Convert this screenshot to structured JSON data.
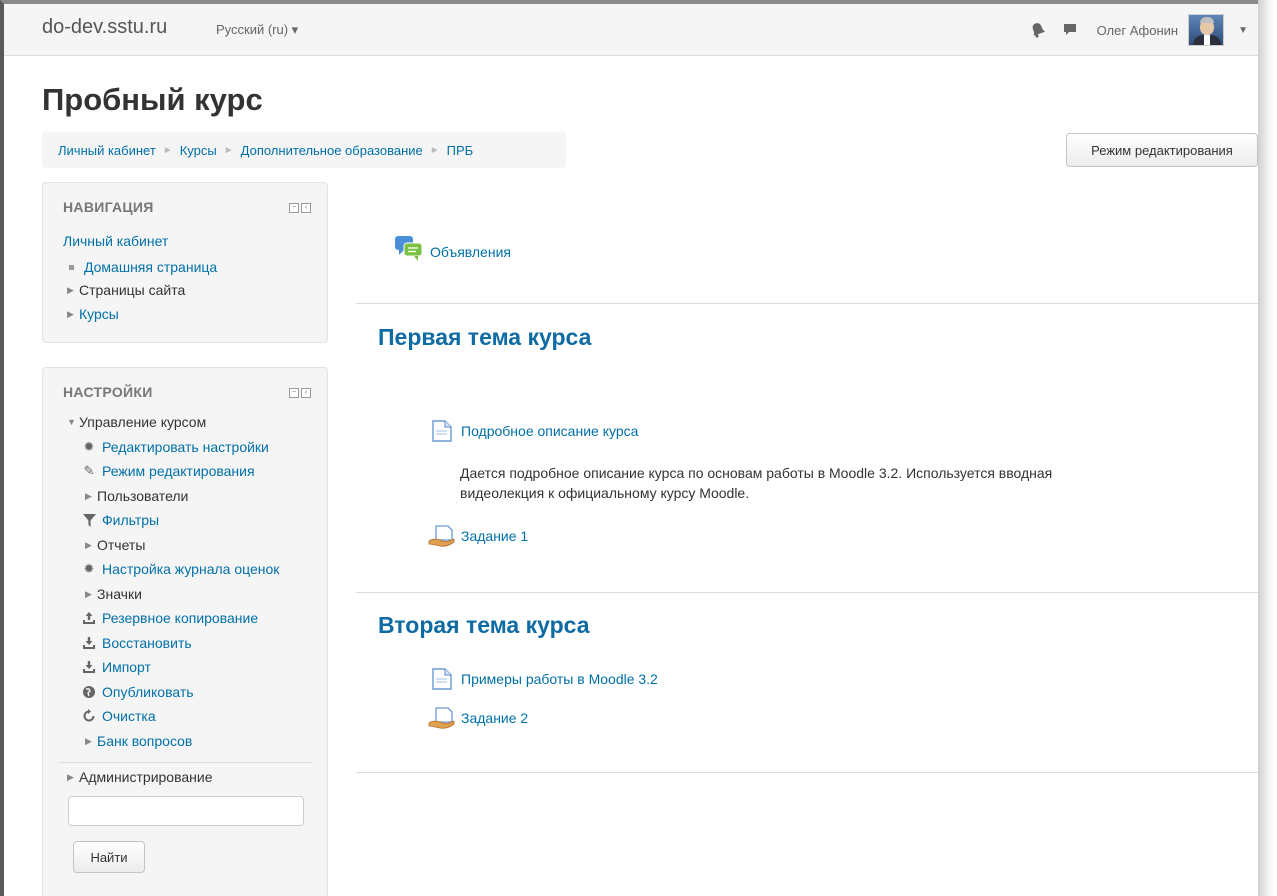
{
  "navbar": {
    "brand": "do-dev.sstu.ru",
    "language": "Русский (ru) ▾",
    "user_name": "Олег Афонин"
  },
  "page": {
    "title": "Пробный курс",
    "edit_button": "Режим редактирования"
  },
  "breadcrumb": [
    "Личный кабинет",
    "Курсы",
    "Дополнительное образование",
    "ПРБ"
  ],
  "navigation_block": {
    "title": "НАВИГАЦИЯ",
    "root": "Личный кабинет",
    "items": [
      "Домашняя страница",
      "Страницы сайта",
      "Курсы"
    ]
  },
  "settings_block": {
    "title": "НАСТРОЙКИ",
    "course_admin": "Управление курсом",
    "items": [
      "Редактировать настройки",
      "Режим редактирования",
      "Пользователи",
      "Фильтры",
      "Отчеты",
      "Настройка журнала оценок",
      "Значки",
      "Резервное копирование",
      "Восстановить",
      "Импорт",
      "Опубликовать",
      "Очистка",
      "Банк вопросов"
    ],
    "site_admin": "Администрирование",
    "search_button": "Найти",
    "search_value": ""
  },
  "course": {
    "announcements": "Объявления",
    "sections": [
      {
        "title": "Первая тема курса",
        "activities": [
          "Подробное описание курса",
          "Задание 1"
        ],
        "summary": "Дается подробное описание курса по основам работы в Moodle 3.2. Используется вводная видеолекция к официальному курсу Moodle."
      },
      {
        "title": "Вторая тема курса",
        "activities": [
          "Примеры работы в Moodle 3.2",
          "Задание 2"
        ]
      }
    ]
  },
  "colors": {
    "link": "#0070a8",
    "section_title": "#0f6ba3",
    "block_bg": "#f5f5f5"
  }
}
